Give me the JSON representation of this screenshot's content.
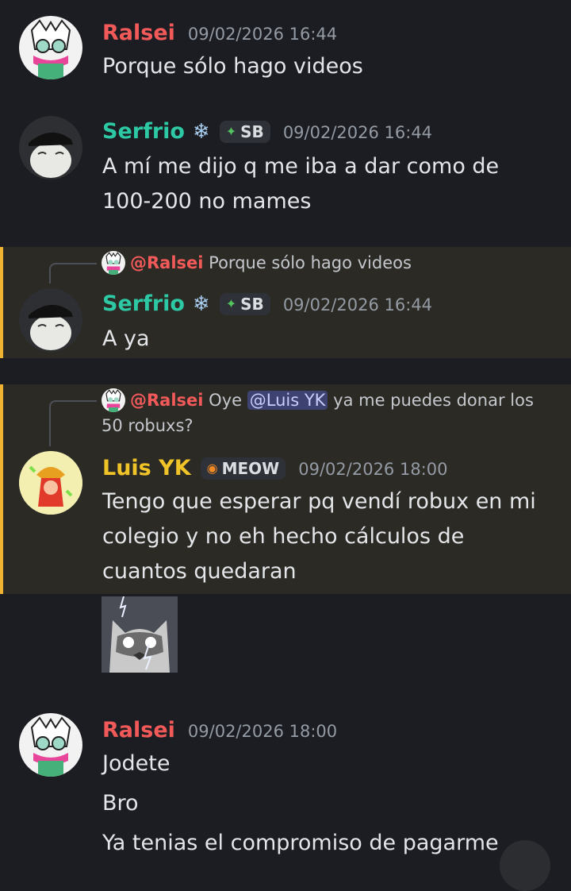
{
  "messages": [
    {
      "author": "Ralsei",
      "timestamp": "09/02/2026 16:44",
      "lines": [
        "Porque sólo hago videos"
      ]
    },
    {
      "author": "Serfrio",
      "emoji": "❄",
      "tag": "SB",
      "tag_icon": "diamond-sparkle-icon",
      "timestamp": "09/02/2026 16:44",
      "lines": [
        "A mí me dijo q me iba a dar como de",
        "100-200 no mames"
      ]
    },
    {
      "author": "Serfrio",
      "emoji": "❄",
      "tag": "SB",
      "tag_icon": "diamond-sparkle-icon",
      "timestamp": "09/02/2026 16:44",
      "highlighted": true,
      "reply_to": {
        "author": "@Ralsei",
        "text": "Porque sólo hago videos"
      },
      "lines": [
        "A ya"
      ]
    },
    {
      "author": "Luis YK",
      "tag": "MEOW",
      "tag_icon": "cat-face-icon",
      "timestamp": "09/02/2026 18:00",
      "highlighted": true,
      "reply_to": {
        "author": "@Ralsei",
        "text_before": "Oye",
        "mention": "@Luis YK",
        "text_after": "ya me puedes donar los 50 robuxs?"
      },
      "lines": [
        "Tengo que esperar pq vendí robux en mi",
        "colegio y no eh hecho cálculos de",
        "cuantos quedaran"
      ],
      "attachment": "cat-lightning-image"
    },
    {
      "author": "Ralsei",
      "timestamp": "09/02/2026 18:00",
      "lines": [
        "Jodete",
        "Bro",
        "Ya tenias el compromiso de pagarme"
      ]
    }
  ],
  "colors": {
    "background": "#1c1d22",
    "highlight_bg": "#2b2a25",
    "highlight_bar": "#f0b232",
    "ralsei": "#f25a5a",
    "serfrio": "#2cc9a4",
    "luis": "#f0c428",
    "timestamp": "#949ba4",
    "mention_bg": "#3e4270"
  }
}
